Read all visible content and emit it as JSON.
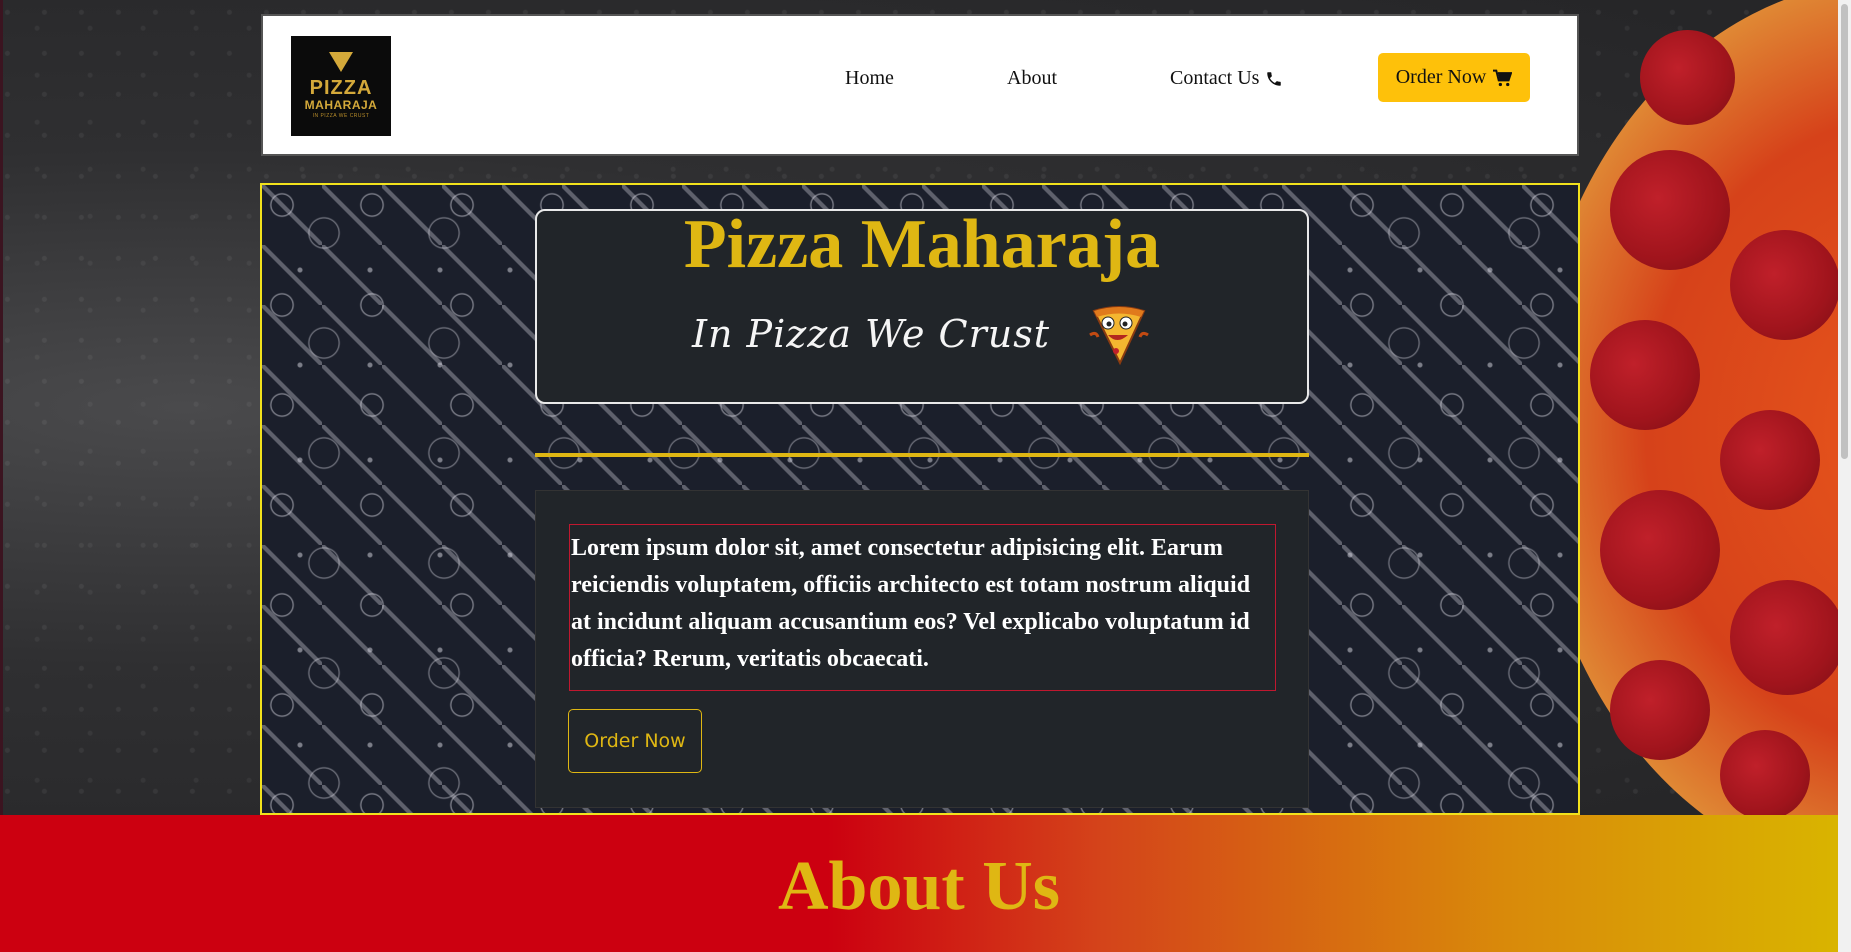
{
  "brand": {
    "logo_line1": "PIZZA",
    "logo_line2": "MAHARAJA",
    "logo_line3": "IN PIZZA WE CRUST"
  },
  "nav": {
    "home": "Home",
    "about": "About",
    "contact": "Contact Us",
    "order": "Order Now",
    "contact_icon": "phone-icon",
    "order_icon": "cart-icon"
  },
  "hero": {
    "title": "Pizza Maharaja",
    "tagline": "In Pizza We Crust",
    "mascot_icon": "pizza-slice-mascot-icon",
    "body": "Lorem ipsum dolor sit, amet consectetur adipisicing elit. Earum reiciendis voluptatem, officiis architecto est totam nostrum aliquid at incidunt aliquam accusantium eos? Vel explicabo voluptatum id officia? Rerum, veritatis obcaecati.",
    "order_button": "Order Now"
  },
  "about": {
    "title": "About Us"
  },
  "colors": {
    "accent_yellow": "#fec10a",
    "title_gold": "#dfb713",
    "hero_border": "#f2e21c",
    "card_bg": "#212529",
    "about_red": "#cc0010"
  }
}
